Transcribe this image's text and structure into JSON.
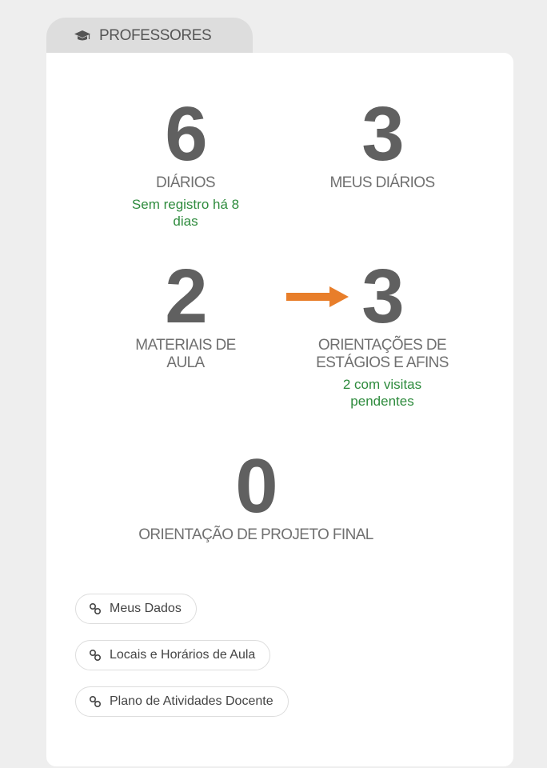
{
  "panel": {
    "tab_label": "PROFESSORES",
    "tab_icon": "graduation-cap-icon"
  },
  "stats": {
    "diarios": {
      "value": "6",
      "label": "DIÁRIOS",
      "note_line1": "Sem registro há 8",
      "note_line2": "dias"
    },
    "meus_diarios": {
      "value": "3",
      "label": "MEUS DIÁRIOS"
    },
    "materiais": {
      "value": "2",
      "label_line1": "MATERIAIS DE",
      "label_line2": "AULA"
    },
    "orientacoes_estagios": {
      "value": "3",
      "label_line1": "ORIENTAÇÕES DE",
      "label_line2": "ESTÁGIOS E AFINS",
      "note_line1": "2 com visitas",
      "note_line2": "pendentes"
    },
    "orientacao_projeto": {
      "value": "0",
      "label": "ORIENTAÇÃO DE PROJETO FINAL"
    }
  },
  "links": [
    {
      "label": "Meus Dados",
      "icon": "link-icon"
    },
    {
      "label": "Locais e Horários de Aula",
      "icon": "link-icon"
    },
    {
      "label": "Plano de Atividades Docente",
      "icon": "link-icon"
    }
  ],
  "colors": {
    "background": "#eeeeee",
    "tab": "#dddddd",
    "card": "#ffffff",
    "number": "#606060",
    "label": "#707070",
    "note_green": "#2e8b3d",
    "arrow_orange": "#e87e2a"
  }
}
